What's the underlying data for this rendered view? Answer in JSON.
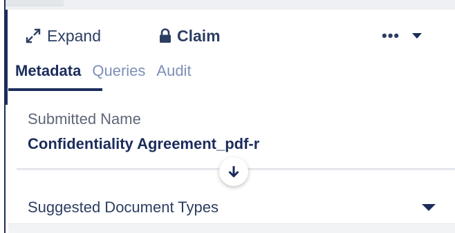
{
  "toolbar": {
    "expand_label": "Expand",
    "expand_icon": "expand-arrows-icon",
    "claim_label": "Claim",
    "claim_icon": "lock-icon",
    "more_label": "•••",
    "more_icon": "chevron-down-icon"
  },
  "tabs": [
    {
      "label": "Metadata",
      "active": true
    },
    {
      "label": "Queries",
      "active": false
    },
    {
      "label": "Audit",
      "active": false
    }
  ],
  "fields": {
    "submitted_name_label": "Submitted Name",
    "submitted_name_value": "Confidentiality Agreement_pdf-r"
  },
  "scroll_button_icon": "arrow-down-icon",
  "suggested": {
    "label": "Suggested Document Types",
    "icon": "caret-down-icon"
  },
  "colors": {
    "primary": "#1c2c5c",
    "tab_inactive": "#7d8fb8",
    "label_gray": "#5e6677"
  }
}
